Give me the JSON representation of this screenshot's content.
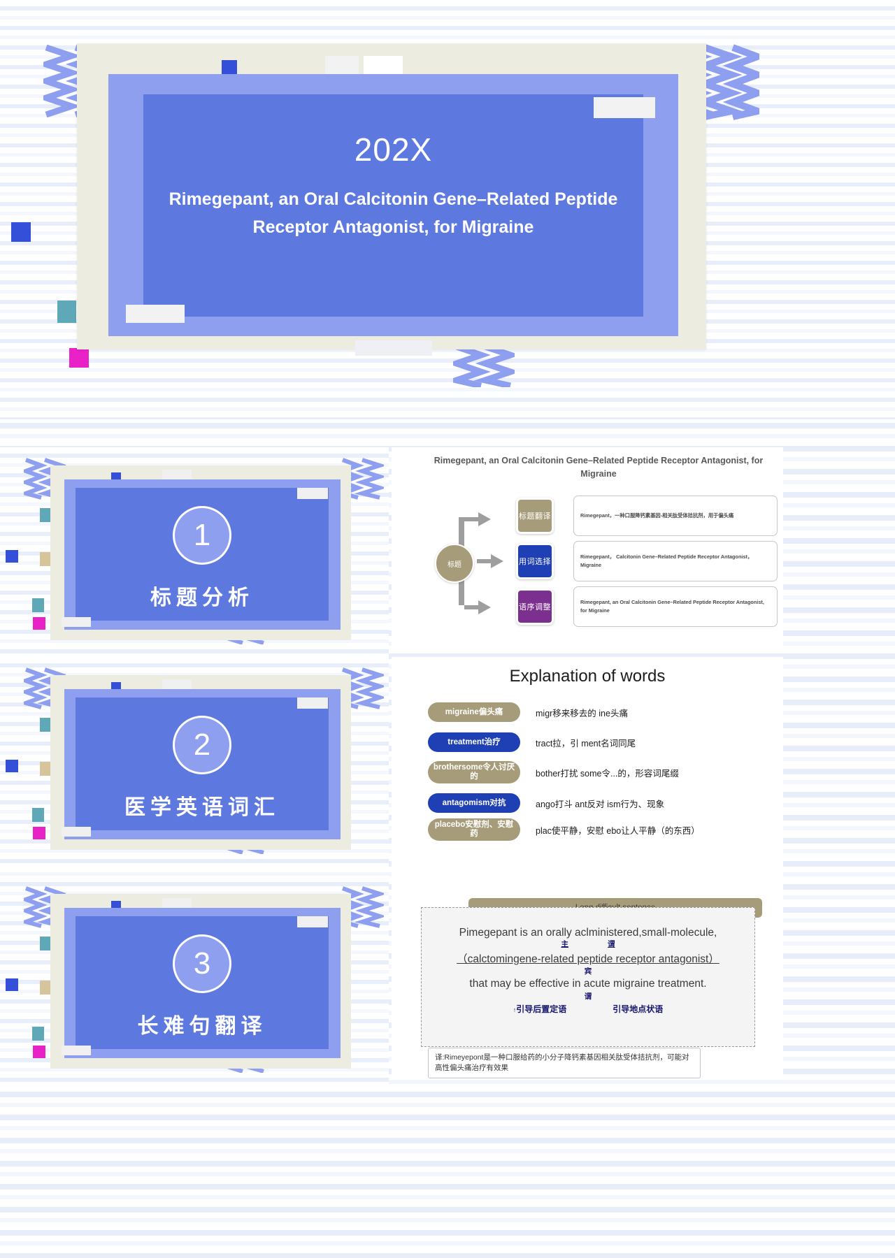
{
  "cover": {
    "year": "202X",
    "title": "Rimegepant, an Oral Calcitonin Gene–Related Peptide Receptor Antagonist, for Migraine"
  },
  "sections": [
    {
      "number": "1",
      "label": "标题分析"
    },
    {
      "number": "2",
      "label": "医学英语词汇"
    },
    {
      "number": "3",
      "label": "长难句翻译"
    }
  ],
  "title_analysis": {
    "heading": "Rimegepant, an Oral Calcitonin Gene–Related Peptide Receptor Antagonist, for Migraine",
    "hub_label": "标题",
    "rows": [
      {
        "tag": "标题翻译",
        "tag_color": "#a79c7a",
        "text": "Rimegepant，一种口服降钙素基因-相关肽受体拮抗剂，用于偏头痛"
      },
      {
        "tag": "用词选择",
        "tag_color": "#1e40b4",
        "text": "Rimegepant， Calcitonin Gene–Related Peptide Receptor Antagonist， Migraine"
      },
      {
        "tag": "语序调整",
        "tag_color": "#7b2f8e",
        "text": "Rimegepant, an Oral Calcitonin Gene–Related Peptide Receptor Antagonist, for Migraine"
      }
    ]
  },
  "vocabulary": {
    "heading": "Explanation of words",
    "items": [
      {
        "word": "migraine偏头痛",
        "color": "#a79c7a",
        "definition": "migr移来移去的  ine头痛"
      },
      {
        "word": "treatment治疗",
        "color": "#1e40b4",
        "definition": "tract拉，引  ment名词同尾"
      },
      {
        "word": "brothersome令人讨厌的",
        "color": "#a79c7a",
        "definition": "bother打扰    some令...的，形容词尾缀"
      },
      {
        "word": "antagomism对抗",
        "color": "#1e40b4",
        "definition": "ango打斗 ant反对 ism行为、现象"
      },
      {
        "word": "placebo安慰剂、安慰药",
        "color": "#a79c7a",
        "definition": "plac使平静，安慰 ebo让人平静（的东西）"
      }
    ]
  },
  "long_sentence": {
    "header": "Long difficult sentence",
    "line1": "Pimegepant is an orally aclministered,small-molecule,",
    "marks1_left": "主",
    "marks1_right": "谓",
    "line2": "（calctomingene-related peptide receptor antagonist）",
    "marks2": "宾",
    "line3": "that may be effective in acute migraine treatment.",
    "marks3": "谓",
    "mark_left_label": "引导后置定语",
    "mark_right_label": "引导地点状语",
    "translation": "译:Rimeyepont是一种口服给药的小分子降钙素基因相关肽受体拮抗剂，可能对高性偏头痛治疗有效果"
  },
  "colors": {
    "accent_blue": "#5d79e0",
    "light_blue": "#8e9ff0",
    "cream": "#ecece1",
    "gold": "#a79c7a",
    "magenta": "#e822c6",
    "teal": "#5fa8b8",
    "tan": "#d6c49a"
  }
}
